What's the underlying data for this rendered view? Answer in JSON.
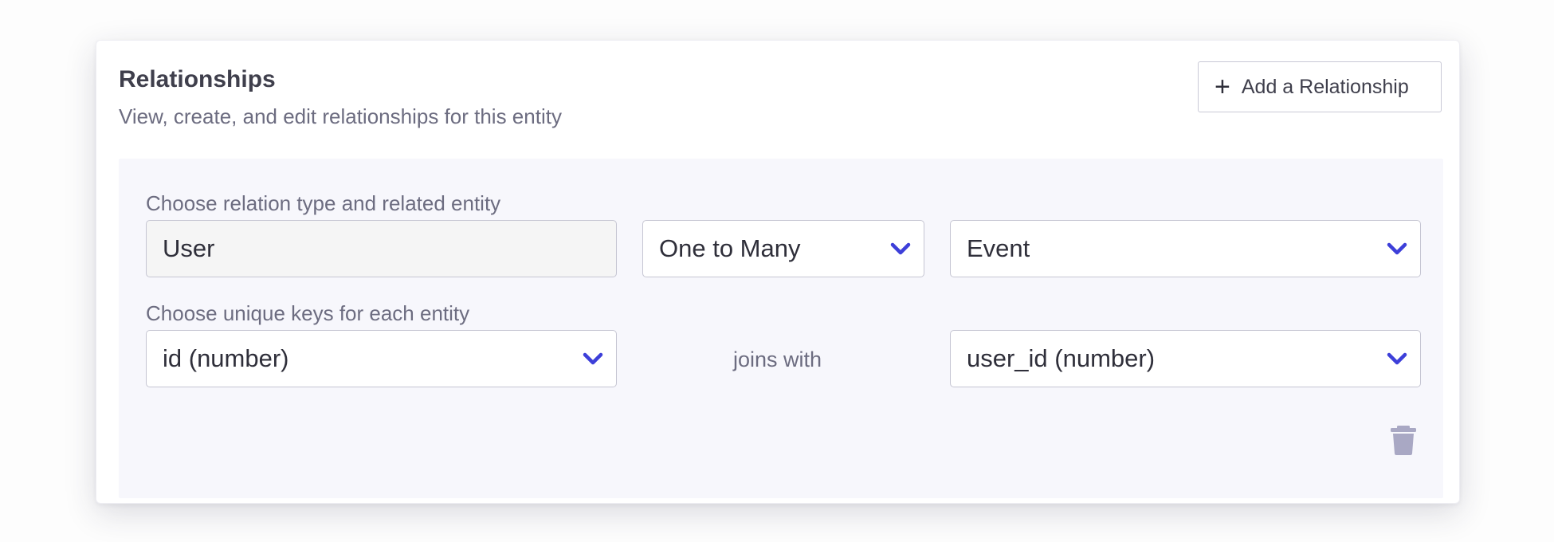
{
  "section": {
    "title": "Relationships",
    "subtitle": "View, create, and edit relationships for this entity"
  },
  "toolbar": {
    "add_icon": "plus-icon",
    "add_label": "Add a Relationship"
  },
  "relation": {
    "label": "Choose relation type and related entity",
    "source_entity": "User",
    "relation_type": "One to Many",
    "related_entity": "Event"
  },
  "keys": {
    "label": "Choose unique keys for each entity",
    "source_key": "id (number)",
    "joins_text": "joins with",
    "related_key": "user_id (number)"
  },
  "icons": {
    "dropdown": "chevron-down-icon",
    "delete": "trash-icon"
  },
  "colors": {
    "accent": "#3d3fd9",
    "trash": "#a9a8c4",
    "panel_bg": "#f7f7fc"
  }
}
